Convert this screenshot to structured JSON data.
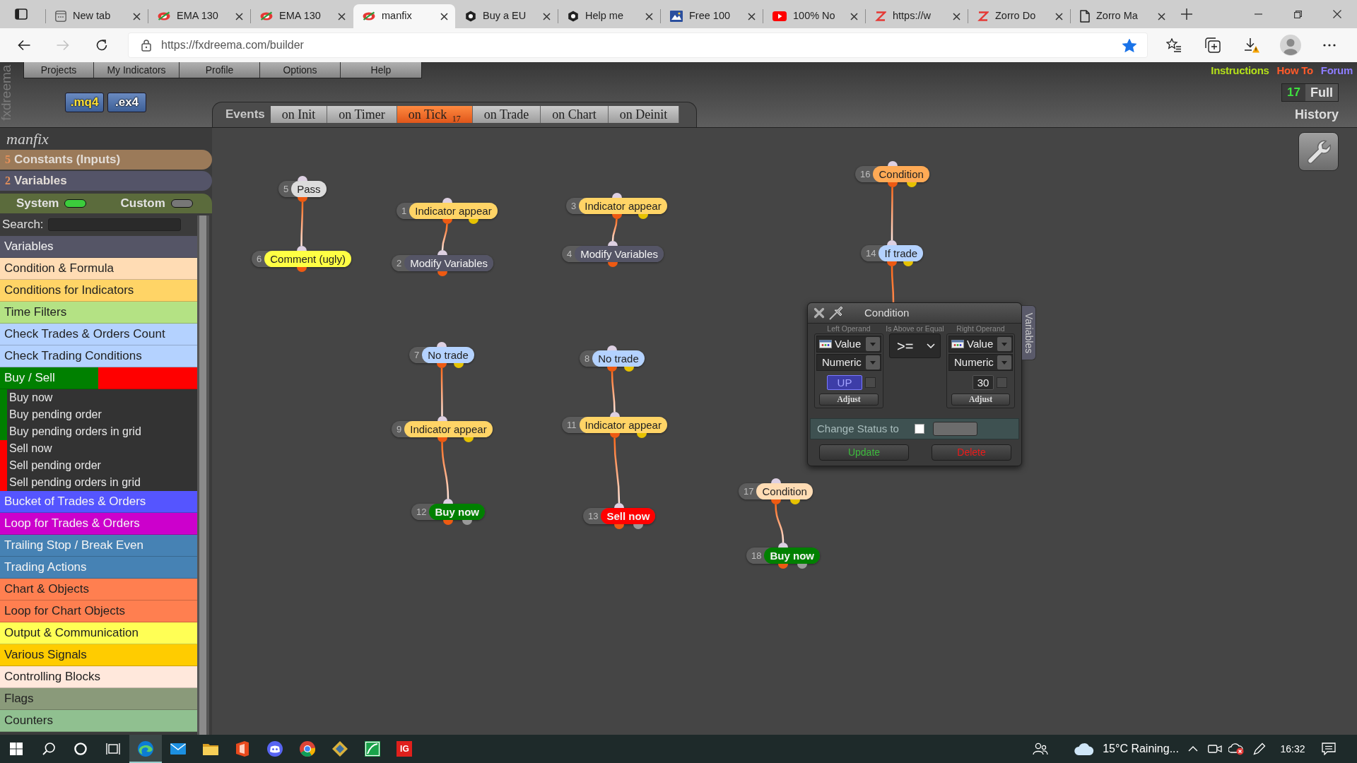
{
  "browser": {
    "tabs": [
      {
        "title": "New tab",
        "kind": "newtab",
        "selected": false
      },
      {
        "title": "EMA 130",
        "kind": "fxdreema",
        "selected": false
      },
      {
        "title": "EMA 130",
        "kind": "fxdreema",
        "selected": false
      },
      {
        "title": "manfix",
        "kind": "fxdreema",
        "selected": true
      },
      {
        "title": "Buy a EU",
        "kind": "hexagon",
        "selected": false
      },
      {
        "title": "Help me",
        "kind": "hexagon",
        "selected": false
      },
      {
        "title": "Free 100",
        "kind": "picture",
        "selected": false
      },
      {
        "title": "100% No",
        "kind": "video",
        "selected": false
      },
      {
        "title": "https://w",
        "kind": "zorro",
        "selected": false
      },
      {
        "title": "Zorro Do",
        "kind": "zorro",
        "selected": false
      },
      {
        "title": "Zorro Ma",
        "kind": "document",
        "selected": false
      }
    ],
    "address": {
      "url": "https://fxdreema.com/builder",
      "bookmarked": true
    },
    "can_go_forward": false
  },
  "header": {
    "logo": "fxdreema",
    "menu": [
      "Projects",
      "My Indicators",
      "Profile",
      "Options",
      "Help"
    ],
    "export_buttons": [
      {
        "label": ".mq4",
        "kind": "source"
      },
      {
        "label": ".ex4",
        "kind": "compiled"
      }
    ],
    "links": [
      {
        "label": "Instructions",
        "color": "#b4e01a"
      },
      {
        "label": "How To",
        "color": "#ff5a2a"
      },
      {
        "label": "Forum",
        "color": "#8d7dff"
      }
    ],
    "history": {
      "count": "17",
      "mode": "Full",
      "label": "History"
    }
  },
  "events": {
    "label": "Events",
    "tabs": [
      {
        "label": "on Init",
        "selected": false
      },
      {
        "label": "on Timer",
        "selected": false
      },
      {
        "label": "on Tick",
        "count": "17",
        "selected": true
      },
      {
        "label": "on Trade",
        "selected": false
      },
      {
        "label": "on Chart",
        "selected": false
      },
      {
        "label": "on Deinit",
        "selected": false
      }
    ]
  },
  "sidebar": {
    "project": "manfix",
    "constants": {
      "count": "5",
      "label": "Constants (Inputs)"
    },
    "variables": {
      "count": "2",
      "label": "Variables"
    },
    "toggles": [
      {
        "label": "System",
        "on": true
      },
      {
        "label": "Custom",
        "on": false
      }
    ],
    "search": {
      "label": "Search:"
    },
    "categories": [
      {
        "label": "Variables",
        "color": "#555566"
      },
      {
        "label": "Condition & Formula",
        "color": "#ffdcb4"
      },
      {
        "label": "Conditions for Indicators",
        "color": "#ffd466"
      },
      {
        "label": "Time Filters",
        "color": "#b4e284"
      },
      {
        "label": "Check Trades & Orders Count",
        "color": "#b4d2ff"
      },
      {
        "label": "Check Trading Conditions",
        "color": "#b4d2ff"
      },
      {
        "label": "Buy / Sell",
        "color": "#008000",
        "expanded": true,
        "children": [
          {
            "label": "Buy now",
            "color": "#008000"
          },
          {
            "label": "Buy pending order",
            "color": "#008000"
          },
          {
            "label": "Buy pending orders in grid",
            "color": "#008000"
          },
          {
            "label": "Sell now",
            "color": "#ff0000"
          },
          {
            "label": "Sell pending order",
            "color": "#ff0000"
          },
          {
            "label": "Sell pending orders in grid",
            "color": "#ff0000"
          }
        ]
      },
      {
        "label": "Bucket of Trades & Orders",
        "color": "#5555ff"
      },
      {
        "label": "Loop for Trades & Orders",
        "color": "#cc00cc"
      },
      {
        "label": "Trailing Stop / Break Even",
        "color": "#4682b4"
      },
      {
        "label": "Trading Actions",
        "color": "#4682b4"
      },
      {
        "label": "Chart & Objects",
        "color": "#ff7f50"
      },
      {
        "label": "Loop for Chart Objects",
        "color": "#ff7f50"
      },
      {
        "label": "Output & Communication",
        "color": "#ffff55"
      },
      {
        "label": "Various Signals",
        "color": "#ffcc00"
      },
      {
        "label": "Controlling Blocks",
        "color": "#ffe8dc"
      },
      {
        "label": "Flags",
        "color": "#8a9a7a"
      },
      {
        "label": "Counters",
        "color": "#90c090"
      }
    ]
  },
  "canvas": {
    "blocks": [
      {
        "number": "5",
        "label": "Pass",
        "kind": "action",
        "color": "#dcdcdc",
        "children": [
          {
            "number": "6",
            "label": "Comment (ugly)",
            "kind": "action",
            "color": "#ffff44"
          }
        ]
      },
      {
        "number": "1",
        "label": "Indicator appear",
        "kind": "condition",
        "color": "#ffd466",
        "children": [
          {
            "number": "2",
            "label": "Modify Variables",
            "kind": "action",
            "color": "#555566"
          }
        ]
      },
      {
        "number": "3",
        "label": "Indicator appear",
        "kind": "condition",
        "color": "#ffd466",
        "children": [
          {
            "number": "4",
            "label": "Modify Variables",
            "kind": "action",
            "color": "#555566"
          }
        ]
      },
      {
        "number": "16",
        "label": "Condition",
        "kind": "condition",
        "color": "#ffaa55",
        "children": [
          {
            "number": "14",
            "label": "If trade",
            "kind": "condition",
            "color": "#b4d2ff",
            "hidden_link": true
          }
        ]
      },
      {
        "number": "7",
        "label": "No trade",
        "kind": "condition",
        "color": "#b4d2ff",
        "children": [
          {
            "number": "9",
            "label": "Indicator appear",
            "kind": "condition",
            "color": "#ffd466",
            "children": [
              {
                "number": "12",
                "label": "Buy now",
                "kind": "trade",
                "color": "#008000"
              }
            ]
          }
        ]
      },
      {
        "number": "8",
        "label": "No trade",
        "kind": "condition",
        "color": "#b4d2ff",
        "children": [
          {
            "number": "11",
            "label": "Indicator appear",
            "kind": "condition",
            "color": "#ffd466",
            "children": [
              {
                "number": "13",
                "label": "Sell now",
                "kind": "trade",
                "color": "#ff0000"
              }
            ]
          }
        ]
      },
      {
        "number": "17",
        "label": "Condition",
        "kind": "condition",
        "color": "#ffdcb4",
        "children": [
          {
            "number": "18",
            "label": "Buy now",
            "kind": "trade",
            "color": "#008000"
          }
        ]
      }
    ]
  },
  "dialog": {
    "title": "Condition",
    "side_tab": "Variables",
    "left": {
      "header": "Left Operand",
      "source": "Value",
      "format": "Numeric",
      "value": "UP",
      "kind": "constant",
      "checked": false,
      "button": "Adjust"
    },
    "operator": {
      "header": "Is Above or Equal",
      "value": ">="
    },
    "right": {
      "header": "Right Operand",
      "source": "Value",
      "format": "Numeric",
      "value": "30",
      "kind": "number",
      "checked": false,
      "button": "Adjust"
    },
    "status": {
      "label": "Change Status to",
      "checked": false
    },
    "buttons": [
      {
        "label": "Update",
        "kind": "update"
      },
      {
        "label": "Delete",
        "kind": "delete"
      }
    ]
  },
  "taskbar": {
    "apps": [
      {
        "kind": "start",
        "active": false
      },
      {
        "kind": "search",
        "active": false
      },
      {
        "kind": "cortana",
        "active": false
      },
      {
        "kind": "taskview",
        "active": false
      },
      {
        "kind": "edge",
        "active": true
      },
      {
        "kind": "mail",
        "active": false
      },
      {
        "kind": "explorer",
        "active": false
      },
      {
        "kind": "office",
        "active": false
      },
      {
        "kind": "discord",
        "active": false
      },
      {
        "kind": "chrome",
        "active": false
      },
      {
        "kind": "app",
        "active": false
      },
      {
        "kind": "green-app",
        "active": false
      },
      {
        "kind": "ig",
        "label": "IG",
        "active": false
      }
    ],
    "weather": "15°C Raining...",
    "clock": "16:32"
  }
}
